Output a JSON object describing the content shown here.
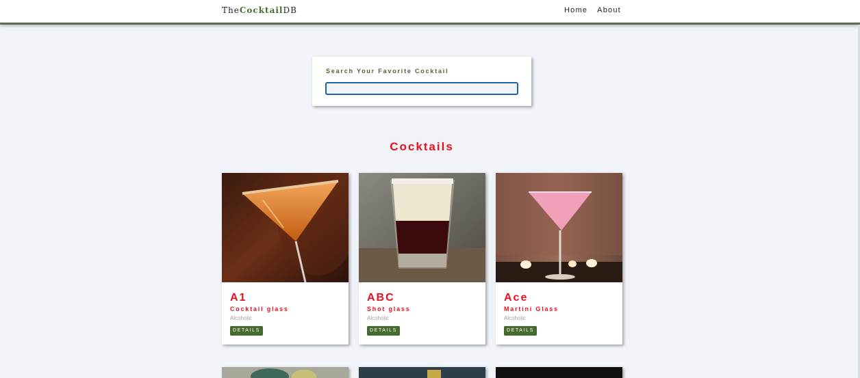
{
  "navbar": {
    "logo_prefix": "The",
    "logo_accent": "Cocktail",
    "logo_suffix": "DB",
    "links": [
      "Home",
      "About"
    ]
  },
  "search": {
    "label": "Search Your Favorite Cocktail",
    "value": ""
  },
  "section_title": "Cocktails",
  "cocktails": [
    {
      "name": "A1",
      "glass": "Cocktail glass",
      "type": "Alcoholic",
      "button": "DETAILS"
    },
    {
      "name": "ABC",
      "glass": "Shot glass",
      "type": "Alcoholic",
      "button": "DETAILS"
    },
    {
      "name": "Ace",
      "glass": "Martini Glass",
      "type": "Alcoholic",
      "button": "DETAILS"
    }
  ],
  "colors": {
    "accent_red": "#e8101e",
    "brand_green": "#476a2e",
    "background": "#f0f4f8"
  }
}
